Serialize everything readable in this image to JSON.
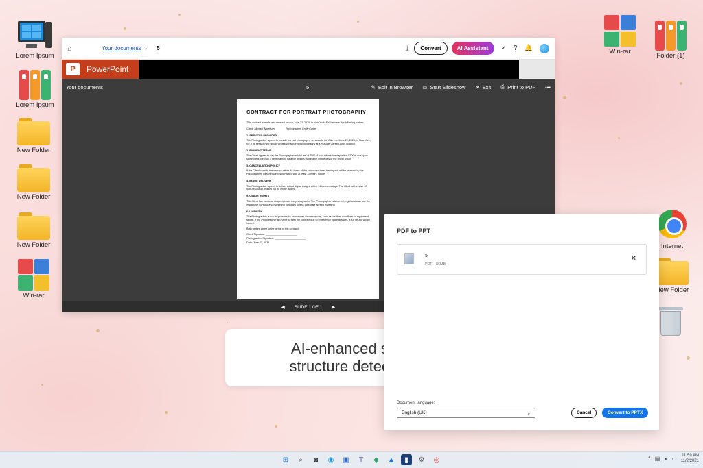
{
  "desktop": {
    "left_icons": [
      {
        "label": "Lorem Ipsum",
        "icon": "computer-icon"
      },
      {
        "label": "Lorem Ipsum",
        "icon": "binders-icon"
      },
      {
        "label": "New Folder",
        "icon": "folder-icon"
      },
      {
        "label": "New Folder",
        "icon": "folder-icon"
      },
      {
        "label": "New Folder",
        "icon": "folder-icon"
      },
      {
        "label": "Win-rar",
        "icon": "winrar-icon"
      }
    ],
    "right_icons": [
      {
        "label": "Win-rar",
        "icon": "winrar-icon"
      },
      {
        "label": "Folder (1)",
        "icon": "binders-icon"
      },
      {
        "label": "Internet",
        "icon": "chrome-icon"
      },
      {
        "label": "New Folder",
        "icon": "folder-icon"
      },
      {
        "label": "",
        "icon": "recycle-bin-icon"
      }
    ]
  },
  "app": {
    "breadcrumb_link": "Your documents",
    "breadcrumb_current": "5",
    "convert_label": "Convert",
    "ai_label": "AI Assistant",
    "brand": "PowerPoint",
    "viewer": {
      "title": "Your documents",
      "page_num": "5",
      "actions": [
        "Edit in Browser",
        "Start Slideshow",
        "Exit",
        "Print to PDF"
      ],
      "footer": "SLIDE 1 OF 1"
    }
  },
  "slide": {
    "title": "CONTRACT FOR PORTRAIT PHOTOGRAPHY",
    "intro": "This contract is made and entered into on June 22, 2025, in New York, NY, between the following parties:",
    "client": "Client: Michael Anderson",
    "photographer": "Photographer: Emily Carter",
    "sections": [
      {
        "h": "1. SERVICES PROVIDED",
        "p": "The Photographer agrees to provide portrait photography services to the Client on June 22, 2025, in New York, NY. The session will include professional portrait photography at a mutually agreed-upon location."
      },
      {
        "h": "2. PAYMENT TERMS",
        "p": "The Client agrees to pay the Photographer a total fee of $500. A non-refundable deposit of $200 is due upon signing this contract. The remaining balance of $300 is payable on the day of the photo shoot."
      },
      {
        "h": "3. CANCELLATION POLICY",
        "p": "If the Client cancels the session within 48 hours of the scheduled time, the deposit will be retained by the Photographer. Rescheduling is permitted with at least 72 hours' notice."
      },
      {
        "h": "4. IMAGE DELIVERY",
        "p": "The Photographer agrees to deliver edited digital images within 14 business days. The Client will receive 20 high-resolution images via an online gallery."
      },
      {
        "h": "5. USAGE RIGHTS",
        "p": "The Client has personal usage rights to the photographs. The Photographer retains copyright and may use the images for portfolio and marketing purposes unless otherwise agreed in writing."
      },
      {
        "h": "6. LIABILITY",
        "p": "The Photographer is not responsible for unforeseen circumstances, such as weather conditions or equipment failure. If the Photographer is unable to fulfill the contract due to emergency circumstances, a full refund will be issued."
      }
    ],
    "closing": "Both parties agree to the terms of this contract.",
    "signatures": [
      "Client Signature: ______________________",
      "Photographer Signature: ______________________",
      "Date: June 22, 2025"
    ]
  },
  "dialog": {
    "title": "PDF to PPT",
    "file_name": "5",
    "file_meta": "PDF - 86MB",
    "language_label": "Document language:",
    "language_value": "English (UK)",
    "cancel_label": "Cancel",
    "convert_label": "Convert to PPTX"
  },
  "caption": {
    "line1": "AI-enhanced slide",
    "line2": "structure detection"
  },
  "taskbar": {
    "time": "11:59 AM",
    "date": "11/2/2021"
  },
  "colors": {
    "ppt_brand": "#c43e1c",
    "primary_blue": "#1473e6",
    "ai_gradient_start": "#e5325c",
    "ai_gradient_end": "#9b3bd9"
  }
}
